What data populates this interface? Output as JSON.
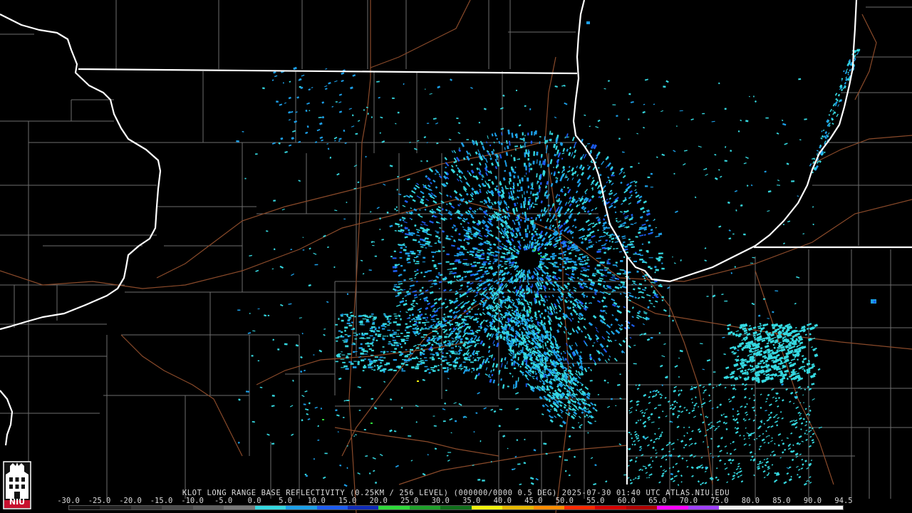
{
  "caption": "KLOT LONG RANGE BASE REFLECTIVITY (0.25KM / 256 LEVEL) (000000/0000 0.5 DEG) 2025-07-30 01:40 UTC  ATLAS.NIU.EDU",
  "scale": {
    "labels": [
      "-30.0",
      "-25.0",
      "-20.0",
      "-15.0",
      "-10.0",
      "-5.0",
      "0.0",
      "5.0",
      "10.0",
      "15.0",
      "20.0",
      "25.0",
      "30.0",
      "35.0",
      "40.0",
      "45.0",
      "50.0",
      "55.0",
      "60.0",
      "65.0",
      "70.0",
      "75.0",
      "80.0",
      "85.0",
      "90.0",
      "94.5"
    ],
    "colors": [
      "#101010",
      "#242424",
      "#383838",
      "#4c4c4c",
      "#606060",
      "#787878",
      "#35d8e0",
      "#1c9fe8",
      "#1d5cf0",
      "#0f2bb8",
      "#2fd93a",
      "#1ea02a",
      "#0f6e1a",
      "#f2f20e",
      "#e6b800",
      "#ff8c00",
      "#ff2a00",
      "#d60000",
      "#b00000",
      "#ff00ff",
      "#a040ff",
      "#f0f0f0",
      "#ffffff",
      "#ffffff",
      "#ffffff"
    ]
  },
  "colors": {
    "background": "#000000",
    "state_border": "#ffffff",
    "county_line": "#6e6e6e",
    "highway": "#8a4a2a",
    "echo_light": "#35d8e0",
    "echo_mid": "#1c9fe8",
    "echo_strong": "#1d5cf0",
    "echo_green": "#2fd93a",
    "echo_yellow": "#f2f20e"
  },
  "logo": {
    "text": "NIU",
    "icon": "niu-seal-icon"
  }
}
